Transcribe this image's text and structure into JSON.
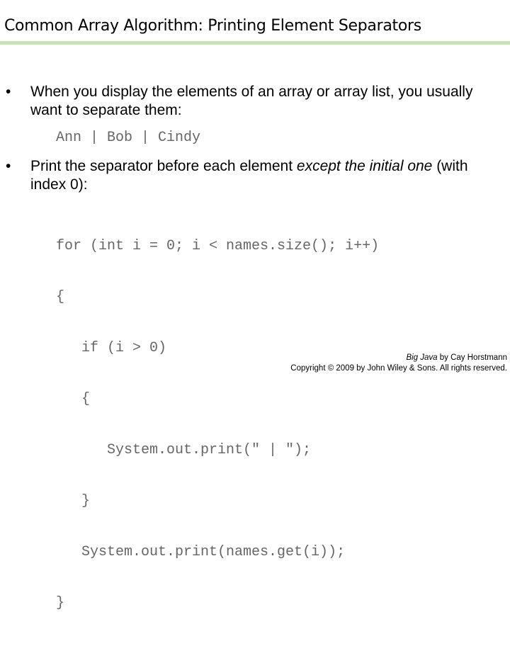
{
  "slide": {
    "title": "Common Array Algorithm: Printing Element Separators",
    "accent_color": "#c6e3b8"
  },
  "bullets": [
    {
      "marker": "•",
      "text": "When you display the elements of an array or array list, you usually want to separate them:",
      "example_output": "Ann | Bob | Cindy"
    },
    {
      "marker": "•",
      "text_before": "Print the separator before each element ",
      "text_emphasis": "except the initial one",
      "text_after": " (with index 0):"
    }
  ],
  "code": {
    "language": "java",
    "lines": [
      "for (int i = 0; i < names.size(); i++)",
      "{",
      "   if (i > 0)",
      "   {",
      "      System.out.print(\" | \");",
      "   }",
      "   System.out.print(names.get(i));",
      "}"
    ]
  },
  "footer": {
    "book_title": "Big Java",
    "by_author": " by Cay Horstmann",
    "copyright": "Copyright © 2009 by John Wiley & Sons.  All rights reserved."
  }
}
